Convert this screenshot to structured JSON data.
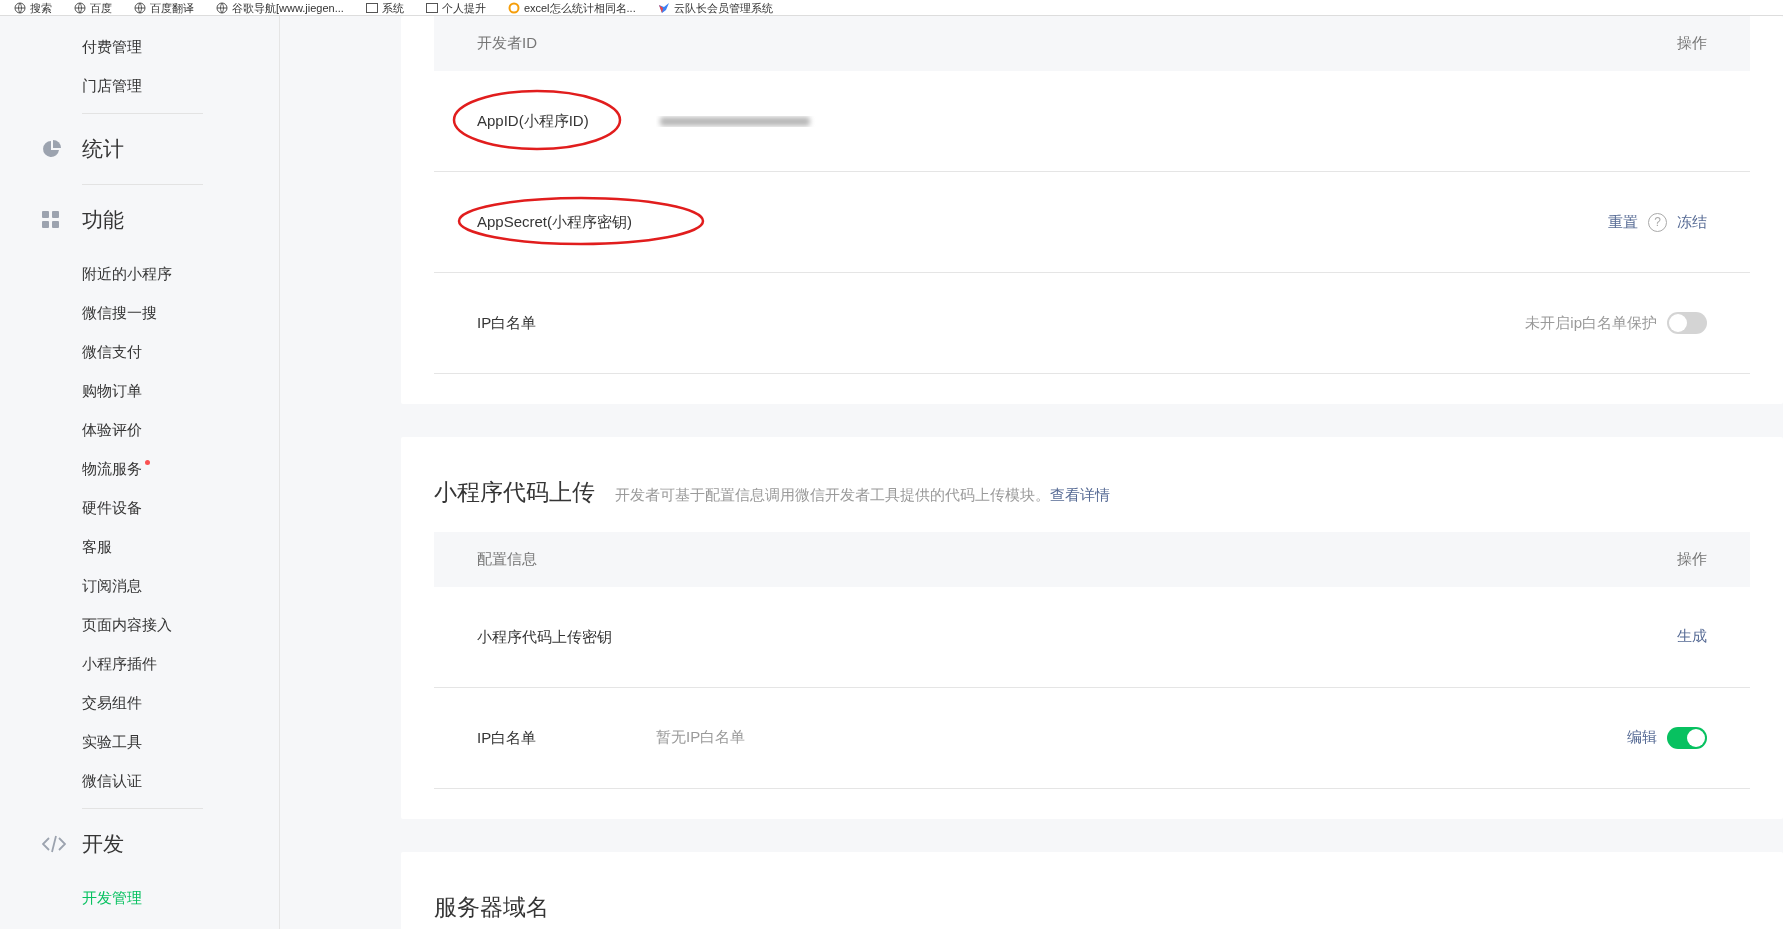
{
  "bookmarks": [
    {
      "label": "搜索",
      "kind": "globe"
    },
    {
      "label": "百度",
      "kind": "globe"
    },
    {
      "label": "百度翻译",
      "kind": "globe"
    },
    {
      "label": "谷歌导航[www.jiegen...",
      "kind": "globe"
    },
    {
      "label": "系统",
      "kind": "folder"
    },
    {
      "label": "个人提升",
      "kind": "folder"
    },
    {
      "label": "excel怎么统计相同名...",
      "kind": "ring"
    },
    {
      "label": "云队长会员管理系统",
      "kind": "bird"
    }
  ],
  "sidebar": {
    "groups": [
      {
        "items": [
          {
            "label": "付费管理",
            "selected": false,
            "dot": false
          },
          {
            "label": "门店管理",
            "selected": false,
            "dot": false
          }
        ]
      },
      {
        "title": "统计"
      },
      {
        "title": "功能",
        "items": [
          {
            "label": "附近的小程序",
            "selected": false,
            "dot": false
          },
          {
            "label": "微信搜一搜",
            "selected": false,
            "dot": false
          },
          {
            "label": "微信支付",
            "selected": false,
            "dot": false
          },
          {
            "label": "购物订单",
            "selected": false,
            "dot": false
          },
          {
            "label": "体验评价",
            "selected": false,
            "dot": false
          },
          {
            "label": "物流服务",
            "selected": false,
            "dot": true
          },
          {
            "label": "硬件设备",
            "selected": false,
            "dot": false
          },
          {
            "label": "客服",
            "selected": false,
            "dot": false
          },
          {
            "label": "订阅消息",
            "selected": false,
            "dot": false
          },
          {
            "label": "页面内容接入",
            "selected": false,
            "dot": false
          },
          {
            "label": "小程序插件",
            "selected": false,
            "dot": false
          },
          {
            "label": "交易组件",
            "selected": false,
            "dot": false
          },
          {
            "label": "实验工具",
            "selected": false,
            "dot": false
          },
          {
            "label": "微信认证",
            "selected": false,
            "dot": false
          }
        ]
      },
      {
        "title": "开发",
        "items": [
          {
            "label": "开发管理",
            "selected": true,
            "dot": false
          }
        ]
      }
    ]
  },
  "cards": [
    {
      "columns": [
        "开发者ID",
        "操作"
      ],
      "rows": [
        {
          "label": "AppID(小程序ID)",
          "circled": true,
          "redacted": true,
          "actions": []
        },
        {
          "label": "AppSecret(小程序密钥)",
          "circled": true,
          "redacted": false,
          "actions": [
            {
              "kind": "link",
              "label": "重置"
            },
            {
              "kind": "help",
              "label": "?"
            },
            {
              "kind": "link",
              "label": "冻结"
            }
          ]
        },
        {
          "label": "IP白名单",
          "circled": false,
          "redacted": false,
          "actions": [
            {
              "kind": "note",
              "label": "未开启ip白名单保护"
            },
            {
              "kind": "toggle",
              "on": false
            }
          ]
        }
      ]
    },
    {
      "title": "小程序代码上传",
      "description": "开发者可基于配置信息调用微信开发者工具提供的代码上传模块。",
      "link": "查看详情",
      "columns": [
        "配置信息",
        "操作"
      ],
      "rows": [
        {
          "label": "小程序代码上传密钥",
          "circled": false,
          "redacted": false,
          "actions": [
            {
              "kind": "link",
              "label": "生成"
            }
          ]
        },
        {
          "label": "IP白名单",
          "circled": false,
          "redacted": false,
          "value": "暂无IP白名单",
          "actions": [
            {
              "kind": "link",
              "label": "编辑"
            },
            {
              "kind": "toggle",
              "on": true
            }
          ]
        }
      ]
    },
    {
      "title": "服务器域名"
    }
  ]
}
